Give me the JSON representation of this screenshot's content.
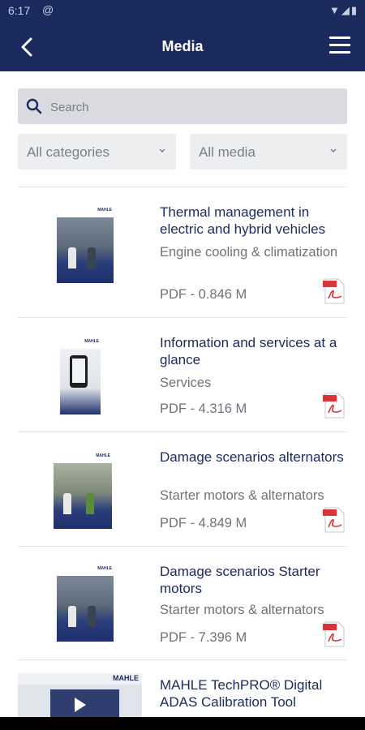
{
  "status": {
    "time": "6:17",
    "extra": "@",
    "icons": "▼◢▮"
  },
  "appbar": {
    "title": "Media",
    "back_icon": "chevron-left-icon",
    "menu_icon": "hamburger-menu-icon"
  },
  "search": {
    "placeholder": "Search",
    "value": ""
  },
  "filters": {
    "category": "All categories",
    "media": "All media"
  },
  "items": [
    {
      "title": "Thermal management in electric and hybrid vehicles",
      "category": "Engine cooling & climatization",
      "meta": "PDF - 0.846 M",
      "brand": "MAHLE"
    },
    {
      "title": "Information and services at a glance",
      "category": "Services",
      "meta": "PDF - 4.316 M",
      "brand": "MAHLE"
    },
    {
      "title": "Damage scenarios alternators",
      "category": "Starter motors & alternators",
      "meta": "PDF - 4.849 M",
      "brand": "MAHLE"
    },
    {
      "title": "Damage scenarios Starter motors",
      "category": "Starter motors & alternators",
      "meta": "PDF - 7.396 M",
      "brand": "MAHLE"
    },
    {
      "title": "MAHLE TechPRO® Digital ADAS Calibration Tool",
      "category": "",
      "meta": "",
      "brand": "MAHLE"
    }
  ],
  "colors": {
    "primary": "#1b2a5c",
    "pdf_red": "#d8343a"
  }
}
